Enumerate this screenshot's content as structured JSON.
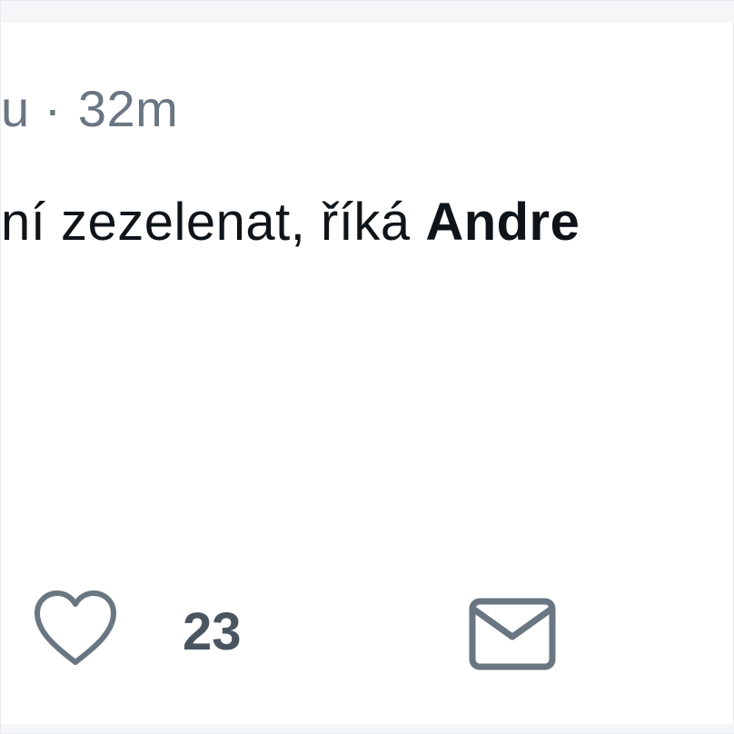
{
  "tweet": {
    "author_fragment": "u",
    "separator": "·",
    "time_ago": "32m",
    "text_prefix": "ní zezelenat, říká ",
    "text_bold": "Andre"
  },
  "actions": {
    "like_icon": "heart-outline-icon",
    "like_count": "23",
    "share_icon": "envelope-icon"
  },
  "colors": {
    "text": "#0f1419",
    "meta": "#6a7681",
    "icon": "#6a7681",
    "count": "#4a5560",
    "band": "#f4f6f8"
  }
}
